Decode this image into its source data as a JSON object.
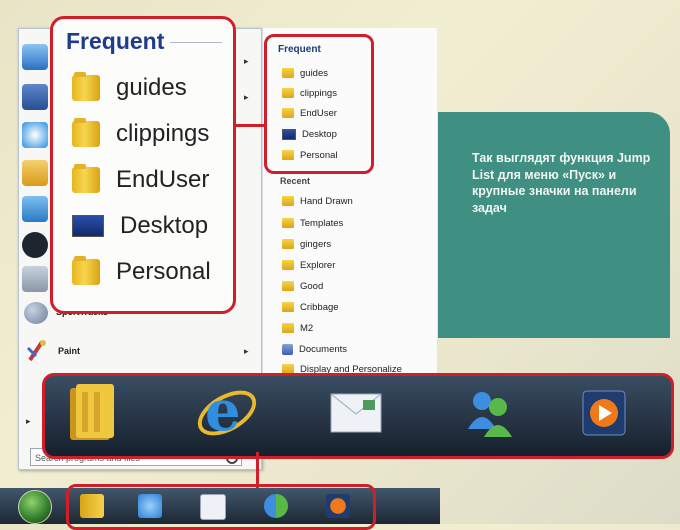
{
  "zoom_callout": {
    "title": "Frequent",
    "items": [
      {
        "label": "guides",
        "icon": "folder-icon"
      },
      {
        "label": "clippings",
        "icon": "folder-icon"
      },
      {
        "label": "EndUser",
        "icon": "folder-icon"
      },
      {
        "label": "Desktop",
        "icon": "desktop-icon"
      },
      {
        "label": "Personal",
        "icon": "folder-icon"
      }
    ]
  },
  "start_menu": {
    "programs": [
      {
        "label": "SportTracks",
        "icon": "sporttracks-icon"
      },
      {
        "label": "Paint",
        "icon": "paint-icon"
      }
    ],
    "search_placeholder": "Search programs and files"
  },
  "jump_list": {
    "frequent_header": "Frequent",
    "frequent_items": [
      "guides",
      "clippings",
      "EndUser",
      "Desktop",
      "Personal"
    ],
    "recent_header": "Recent",
    "recent_items": [
      {
        "label": "Hand Drawn",
        "icon": "folder-icon"
      },
      {
        "label": "Templates",
        "icon": "folder-icon"
      },
      {
        "label": "gingers",
        "icon": "folder-icon"
      },
      {
        "label": "Explorer",
        "icon": "folder-icon"
      },
      {
        "label": "Good",
        "icon": "folder-icon"
      },
      {
        "label": "Cribbage",
        "icon": "folder-icon"
      },
      {
        "label": "M2",
        "icon": "folder-icon"
      },
      {
        "label": "Documents",
        "icon": "documents-icon"
      },
      {
        "label": "Display and Personalize",
        "icon": "folder-icon"
      }
    ]
  },
  "info_box": {
    "text": "Так выглядят функция Jump List для меню «Пуск» и крупные значки на панели задач"
  },
  "taskbar": {
    "icons": [
      "explorer-folder-icon",
      "internet-explorer-icon",
      "mail-icon",
      "messenger-icon",
      "media-player-icon"
    ]
  },
  "colors": {
    "highlight": "#d01f2a",
    "info_box": "#3f8f82",
    "taskbar": "#1c2733",
    "title_blue": "#1f3c8c"
  }
}
